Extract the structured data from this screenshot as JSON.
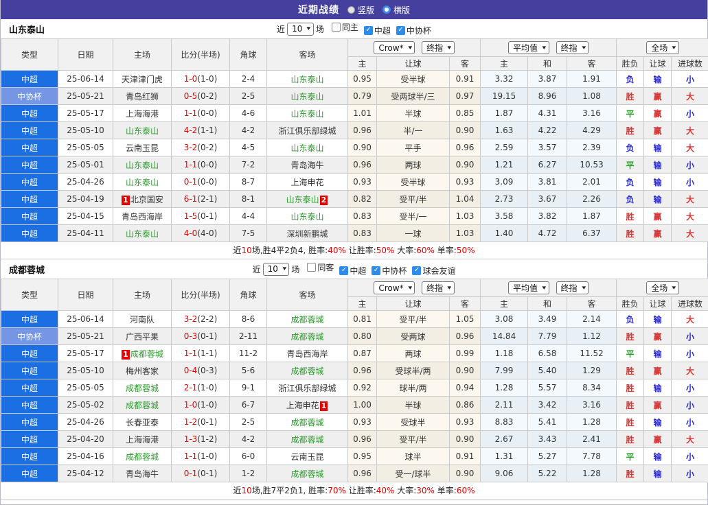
{
  "header": {
    "title": "近期战绩",
    "radios": [
      {
        "label": "竖版",
        "selected": false
      },
      {
        "label": "横版",
        "selected": true
      }
    ]
  },
  "palette": {
    "titlebar_bg": "#453f9e",
    "type_colors": {
      "中超": "#1c6fe2",
      "中协杯": "#7596e4"
    },
    "team_highlight": "#2e9b2e",
    "score_red": "#e60000",
    "badge_bg": "#e60000",
    "checkbox_blue": "#2b8ceb",
    "result_colors": {
      "胜": "red",
      "赢": "red",
      "大": "red",
      "平": "green",
      "负": "blue",
      "输": "blue",
      "小": "blue"
    }
  },
  "table": {
    "basic_cols": [
      "类型",
      "日期",
      "主场",
      "比分(半场)",
      "角球",
      "客场"
    ],
    "sub_cols": [
      "主",
      "让球",
      "客",
      "主",
      "和",
      "客",
      "胜负",
      "让球",
      "进球数"
    ],
    "dropdowns": {
      "odds_source": "Crow*",
      "odds_final": "终指",
      "avg": "平均值",
      "avg_final": "终指",
      "full": "全场"
    }
  },
  "sections": [
    {
      "team": "山东泰山",
      "filter": {
        "prefix": "近",
        "count": "10",
        "suffix": "场",
        "checkboxes": [
          {
            "label": "同主",
            "checked": false
          },
          {
            "label": "中超",
            "checked": true
          },
          {
            "label": "中协杯",
            "checked": true
          }
        ]
      },
      "rows": [
        {
          "type": "中超",
          "date": "25-06-14",
          "home": {
            "name": "天津津门虎"
          },
          "score": "1-0",
          "half": "(1-0)",
          "corner": "2-4",
          "away": {
            "name": "山东泰山",
            "hl": true
          },
          "o1": "0.95",
          "line": "受半球",
          "o2": "0.91",
          "a1": "3.32",
          "a2": "3.87",
          "a3": "1.91",
          "r1": "负",
          "r2": "输",
          "r3": "小"
        },
        {
          "type": "中协杯",
          "date": "25-05-21",
          "home": {
            "name": "青岛红狮"
          },
          "score": "0-5",
          "half": "(0-2)",
          "corner": "2-5",
          "away": {
            "name": "山东泰山",
            "hl": true
          },
          "o1": "0.79",
          "line": "受两球半/三",
          "o2": "0.97",
          "a1": "19.15",
          "a2": "8.96",
          "a3": "1.08",
          "r1": "胜",
          "r2": "赢",
          "r3": "大"
        },
        {
          "type": "中超",
          "date": "25-05-17",
          "home": {
            "name": "上海海港"
          },
          "score": "1-1",
          "half": "(0-0)",
          "corner": "4-6",
          "away": {
            "name": "山东泰山",
            "hl": true
          },
          "o1": "1.01",
          "line": "半球",
          "o2": "0.85",
          "a1": "1.87",
          "a2": "4.31",
          "a3": "3.16",
          "r1": "平",
          "r2": "赢",
          "r3": "小"
        },
        {
          "type": "中超",
          "date": "25-05-10",
          "home": {
            "name": "山东泰山",
            "hl": true
          },
          "score": "4-2",
          "half": "(1-1)",
          "corner": "4-2",
          "away": {
            "name": "浙江俱乐部绿城"
          },
          "o1": "0.96",
          "line": "半/一",
          "o2": "0.90",
          "a1": "1.63",
          "a2": "4.22",
          "a3": "4.29",
          "r1": "胜",
          "r2": "赢",
          "r3": "大"
        },
        {
          "type": "中超",
          "date": "25-05-05",
          "home": {
            "name": "云南玉昆"
          },
          "score": "3-2",
          "half": "(0-2)",
          "corner": "4-5",
          "away": {
            "name": "山东泰山",
            "hl": true
          },
          "o1": "0.90",
          "line": "平手",
          "o2": "0.96",
          "a1": "2.59",
          "a2": "3.57",
          "a3": "2.39",
          "r1": "负",
          "r2": "输",
          "r3": "大"
        },
        {
          "type": "中超",
          "date": "25-05-01",
          "home": {
            "name": "山东泰山",
            "hl": true
          },
          "score": "1-1",
          "half": "(0-0)",
          "corner": "7-2",
          "away": {
            "name": "青岛海牛"
          },
          "o1": "0.96",
          "line": "两球",
          "o2": "0.90",
          "a1": "1.21",
          "a2": "6.27",
          "a3": "10.53",
          "r1": "平",
          "r2": "输",
          "r3": "小"
        },
        {
          "type": "中超",
          "date": "25-04-26",
          "home": {
            "name": "山东泰山",
            "hl": true
          },
          "score": "0-1",
          "half": "(0-0)",
          "corner": "8-7",
          "away": {
            "name": "上海申花"
          },
          "o1": "0.93",
          "line": "受半球",
          "o2": "0.93",
          "a1": "3.09",
          "a2": "3.81",
          "a3": "2.01",
          "r1": "负",
          "r2": "输",
          "r3": "小"
        },
        {
          "type": "中超",
          "date": "25-04-19",
          "home": {
            "name": "北京国安",
            "b1": "1"
          },
          "score": "6-1",
          "half": "(2-1)",
          "corner": "8-1",
          "away": {
            "name": "山东泰山",
            "hl": true,
            "b2": "2"
          },
          "o1": "0.82",
          "line": "受平/半",
          "o2": "1.04",
          "a1": "2.73",
          "a2": "3.67",
          "a3": "2.26",
          "r1": "负",
          "r2": "输",
          "r3": "大"
        },
        {
          "type": "中超",
          "date": "25-04-15",
          "home": {
            "name": "青岛西海岸"
          },
          "score": "1-5",
          "half": "(0-1)",
          "corner": "4-4",
          "away": {
            "name": "山东泰山",
            "hl": true
          },
          "o1": "0.83",
          "line": "受半/一",
          "o2": "1.03",
          "a1": "3.58",
          "a2": "3.82",
          "a3": "1.87",
          "r1": "胜",
          "r2": "赢",
          "r3": "大"
        },
        {
          "type": "中超",
          "date": "25-04-11",
          "home": {
            "name": "山东泰山",
            "hl": true
          },
          "score": "4-0",
          "half": "(4-0)",
          "corner": "7-5",
          "away": {
            "name": "深圳新鹏城"
          },
          "o1": "0.83",
          "line": "一球",
          "o2": "1.03",
          "a1": "1.40",
          "a2": "4.72",
          "a3": "6.37",
          "r1": "胜",
          "r2": "赢",
          "r3": "大"
        }
      ],
      "summary": [
        {
          "t": "近"
        },
        {
          "t": "10",
          "red": true
        },
        {
          "t": "场,胜4平2负4, 胜率:"
        },
        {
          "t": "40%",
          "red": true
        },
        {
          "t": " 让胜率:"
        },
        {
          "t": "50%",
          "red": true
        },
        {
          "t": " 大率:"
        },
        {
          "t": "60%",
          "red": true
        },
        {
          "t": " 单率:"
        },
        {
          "t": "50%",
          "red": true
        }
      ]
    },
    {
      "team": "成都蓉城",
      "filter": {
        "prefix": "近",
        "count": "10",
        "suffix": "场",
        "checkboxes": [
          {
            "label": "同客",
            "checked": false
          },
          {
            "label": "中超",
            "checked": true
          },
          {
            "label": "中协杯",
            "checked": true
          },
          {
            "label": "球会友谊",
            "checked": true
          }
        ]
      },
      "rows": [
        {
          "type": "中超",
          "date": "25-06-14",
          "home": {
            "name": "河南队"
          },
          "score": "3-2",
          "half": "(2-2)",
          "corner": "8-6",
          "away": {
            "name": "成都蓉城",
            "hl": true
          },
          "o1": "0.81",
          "line": "受平/半",
          "o2": "1.05",
          "a1": "3.08",
          "a2": "3.49",
          "a3": "2.14",
          "r1": "负",
          "r2": "输",
          "r3": "大"
        },
        {
          "type": "中协杯",
          "date": "25-05-21",
          "home": {
            "name": "广西平果"
          },
          "score": "0-3",
          "half": "(0-1)",
          "corner": "2-11",
          "away": {
            "name": "成都蓉城",
            "hl": true
          },
          "o1": "0.80",
          "line": "受两球",
          "o2": "0.96",
          "a1": "14.84",
          "a2": "7.79",
          "a3": "1.12",
          "r1": "胜",
          "r2": "赢",
          "r3": "小"
        },
        {
          "type": "中超",
          "date": "25-05-17",
          "home": {
            "name": "成都蓉城",
            "hl": true,
            "b1": "1"
          },
          "score": "1-1",
          "half": "(1-1)",
          "corner": "11-2",
          "away": {
            "name": "青岛西海岸"
          },
          "o1": "0.87",
          "line": "两球",
          "o2": "0.99",
          "a1": "1.18",
          "a2": "6.58",
          "a3": "11.52",
          "r1": "平",
          "r2": "输",
          "r3": "小"
        },
        {
          "type": "中超",
          "date": "25-05-10",
          "home": {
            "name": "梅州客家"
          },
          "score": "0-4",
          "half": "(0-3)",
          "corner": "5-6",
          "away": {
            "name": "成都蓉城",
            "hl": true
          },
          "o1": "0.96",
          "line": "受球半/两",
          "o2": "0.90",
          "a1": "7.99",
          "a2": "5.40",
          "a3": "1.29",
          "r1": "胜",
          "r2": "赢",
          "r3": "大"
        },
        {
          "type": "中超",
          "date": "25-05-05",
          "home": {
            "name": "成都蓉城",
            "hl": true
          },
          "score": "2-1",
          "half": "(1-0)",
          "corner": "9-1",
          "away": {
            "name": "浙江俱乐部绿城"
          },
          "o1": "0.92",
          "line": "球半/两",
          "o2": "0.94",
          "a1": "1.28",
          "a2": "5.57",
          "a3": "8.34",
          "r1": "胜",
          "r2": "输",
          "r3": "小"
        },
        {
          "type": "中超",
          "date": "25-05-02",
          "home": {
            "name": "成都蓉城",
            "hl": true
          },
          "score": "1-0",
          "half": "(1-0)",
          "corner": "6-7",
          "away": {
            "name": "上海申花",
            "b2": "1"
          },
          "o1": "1.00",
          "line": "半球",
          "o2": "0.86",
          "a1": "2.11",
          "a2": "3.42",
          "a3": "3.16",
          "r1": "胜",
          "r2": "赢",
          "r3": "小"
        },
        {
          "type": "中超",
          "date": "25-04-26",
          "home": {
            "name": "长春亚泰"
          },
          "score": "1-2",
          "half": "(0-1)",
          "corner": "2-5",
          "away": {
            "name": "成都蓉城",
            "hl": true
          },
          "o1": "0.93",
          "line": "受球半",
          "o2": "0.93",
          "a1": "8.83",
          "a2": "5.41",
          "a3": "1.28",
          "r1": "胜",
          "r2": "输",
          "r3": "小"
        },
        {
          "type": "中超",
          "date": "25-04-20",
          "home": {
            "name": "上海海港"
          },
          "score": "1-3",
          "half": "(1-2)",
          "corner": "4-2",
          "away": {
            "name": "成都蓉城",
            "hl": true
          },
          "o1": "0.96",
          "line": "受平/半",
          "o2": "0.90",
          "a1": "2.67",
          "a2": "3.43",
          "a3": "2.41",
          "r1": "胜",
          "r2": "赢",
          "r3": "大"
        },
        {
          "type": "中超",
          "date": "25-04-16",
          "home": {
            "name": "成都蓉城",
            "hl": true
          },
          "score": "1-1",
          "half": "(1-0)",
          "corner": "6-0",
          "away": {
            "name": "云南玉昆"
          },
          "o1": "0.95",
          "line": "球半",
          "o2": "0.91",
          "a1": "1.31",
          "a2": "5.27",
          "a3": "7.78",
          "r1": "平",
          "r2": "输",
          "r3": "小"
        },
        {
          "type": "中超",
          "date": "25-04-12",
          "home": {
            "name": "青岛海牛"
          },
          "score": "0-1",
          "half": "(0-1)",
          "corner": "1-2",
          "away": {
            "name": "成都蓉城",
            "hl": true
          },
          "o1": "0.96",
          "line": "受一/球半",
          "o2": "0.90",
          "a1": "9.06",
          "a2": "5.22",
          "a3": "1.28",
          "r1": "胜",
          "r2": "输",
          "r3": "小"
        }
      ],
      "summary": [
        {
          "t": "近"
        },
        {
          "t": "10",
          "red": true
        },
        {
          "t": "场,胜7平2负1, 胜率:"
        },
        {
          "t": "70%",
          "red": true
        },
        {
          "t": " 让胜率:"
        },
        {
          "t": "40%",
          "red": true
        },
        {
          "t": " 大率:"
        },
        {
          "t": "30%",
          "red": true
        },
        {
          "t": " 单率:"
        },
        {
          "t": "60%",
          "red": true
        }
      ]
    }
  ]
}
